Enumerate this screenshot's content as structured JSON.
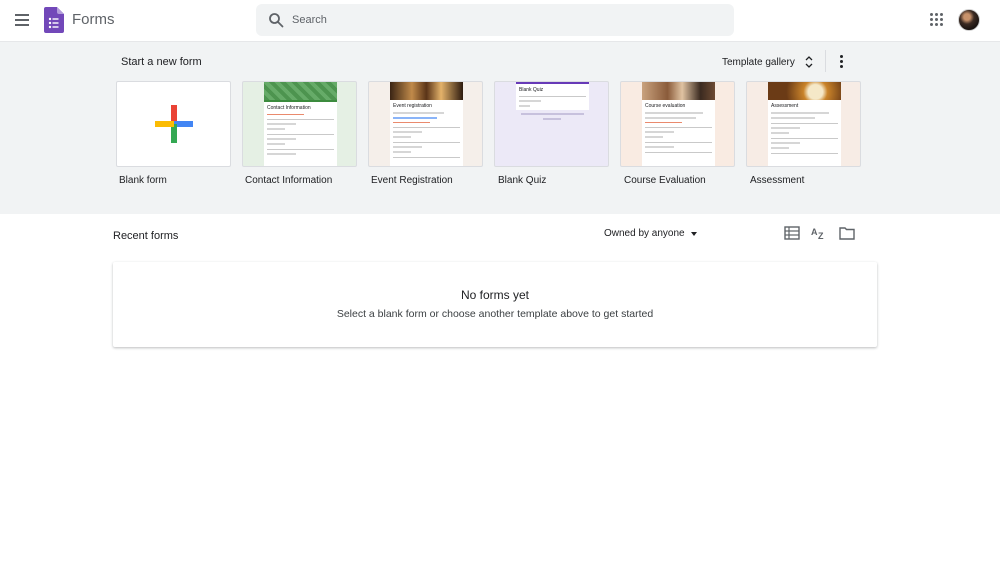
{
  "header": {
    "app_title": "Forms",
    "search_placeholder": "Search"
  },
  "templates": {
    "section_title": "Start a new form",
    "gallery_label": "Template gallery",
    "items": [
      {
        "label": "Blank form"
      },
      {
        "label": "Contact Information",
        "thumb_title": "Contact Information",
        "bg": "#e5f0e4",
        "header_color": "#3c8b3e"
      },
      {
        "label": "Event Registration",
        "thumb_title": "Event registration",
        "bg": "#f5efea",
        "header_color": "#6b3d1e"
      },
      {
        "label": "Blank Quiz",
        "thumb_title": "Blank Quiz",
        "bg": "#ece9f7",
        "header_color": "#673ab7"
      },
      {
        "label": "Course Evaluation",
        "thumb_title": "Course evaluation",
        "bg": "#f9ebe2",
        "header_color": "#b5653b"
      },
      {
        "label": "Assessment",
        "thumb_title": "Assessment",
        "bg": "#f7ece5",
        "header_color": "#8d5a33"
      }
    ]
  },
  "recent": {
    "title": "Recent forms",
    "owner_filter": "Owned by anyone",
    "empty_title": "No forms yet",
    "empty_subtitle": "Select a blank form or choose another template above to get started"
  },
  "colors": {
    "brand_purple": "#673ab7",
    "band_bg": "#f1f3f4"
  }
}
